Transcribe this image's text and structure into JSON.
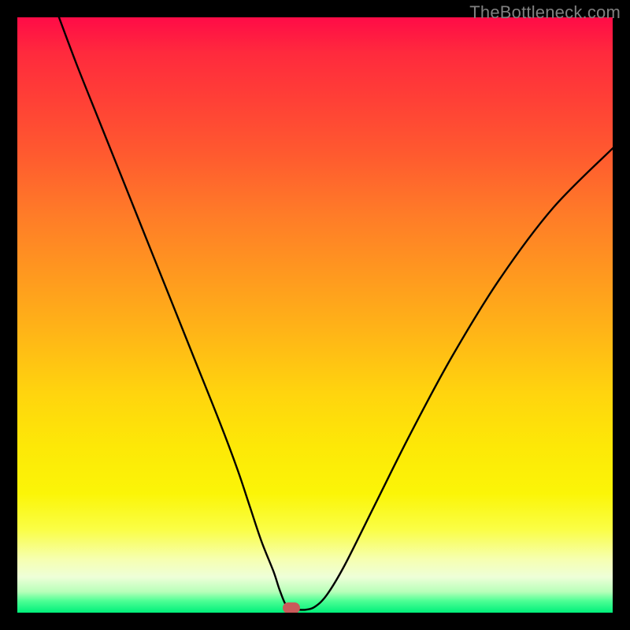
{
  "watermark": "TheBottleneck.com",
  "chart_data": {
    "type": "line",
    "title": "",
    "xlabel": "",
    "ylabel": "",
    "xlim": [
      0,
      100
    ],
    "ylim": [
      0,
      100
    ],
    "series": [
      {
        "name": "bottleneck-curve",
        "x": [
          7,
          10,
          14,
          18,
          22,
          26,
          30,
          34,
          37,
          39,
          41,
          43,
          44,
          45,
          46,
          47,
          48.5,
          50,
          52,
          55,
          60,
          66,
          73,
          81,
          90,
          100
        ],
        "y": [
          100,
          92,
          82,
          72,
          62,
          52,
          42,
          32,
          24,
          18,
          12,
          7,
          4,
          1.5,
          0.5,
          0.5,
          0.5,
          1,
          3,
          8,
          18,
          30,
          43,
          56,
          68,
          78
        ]
      }
    ],
    "marker": {
      "x": 46,
      "y": 0.8,
      "color": "#c95a5a"
    },
    "background_gradient": {
      "top": "#ff0b47",
      "mid_upper": "#ff981f",
      "mid": "#fde807",
      "mid_lower": "#f6ffb0",
      "bottom": "#00f07a"
    }
  }
}
